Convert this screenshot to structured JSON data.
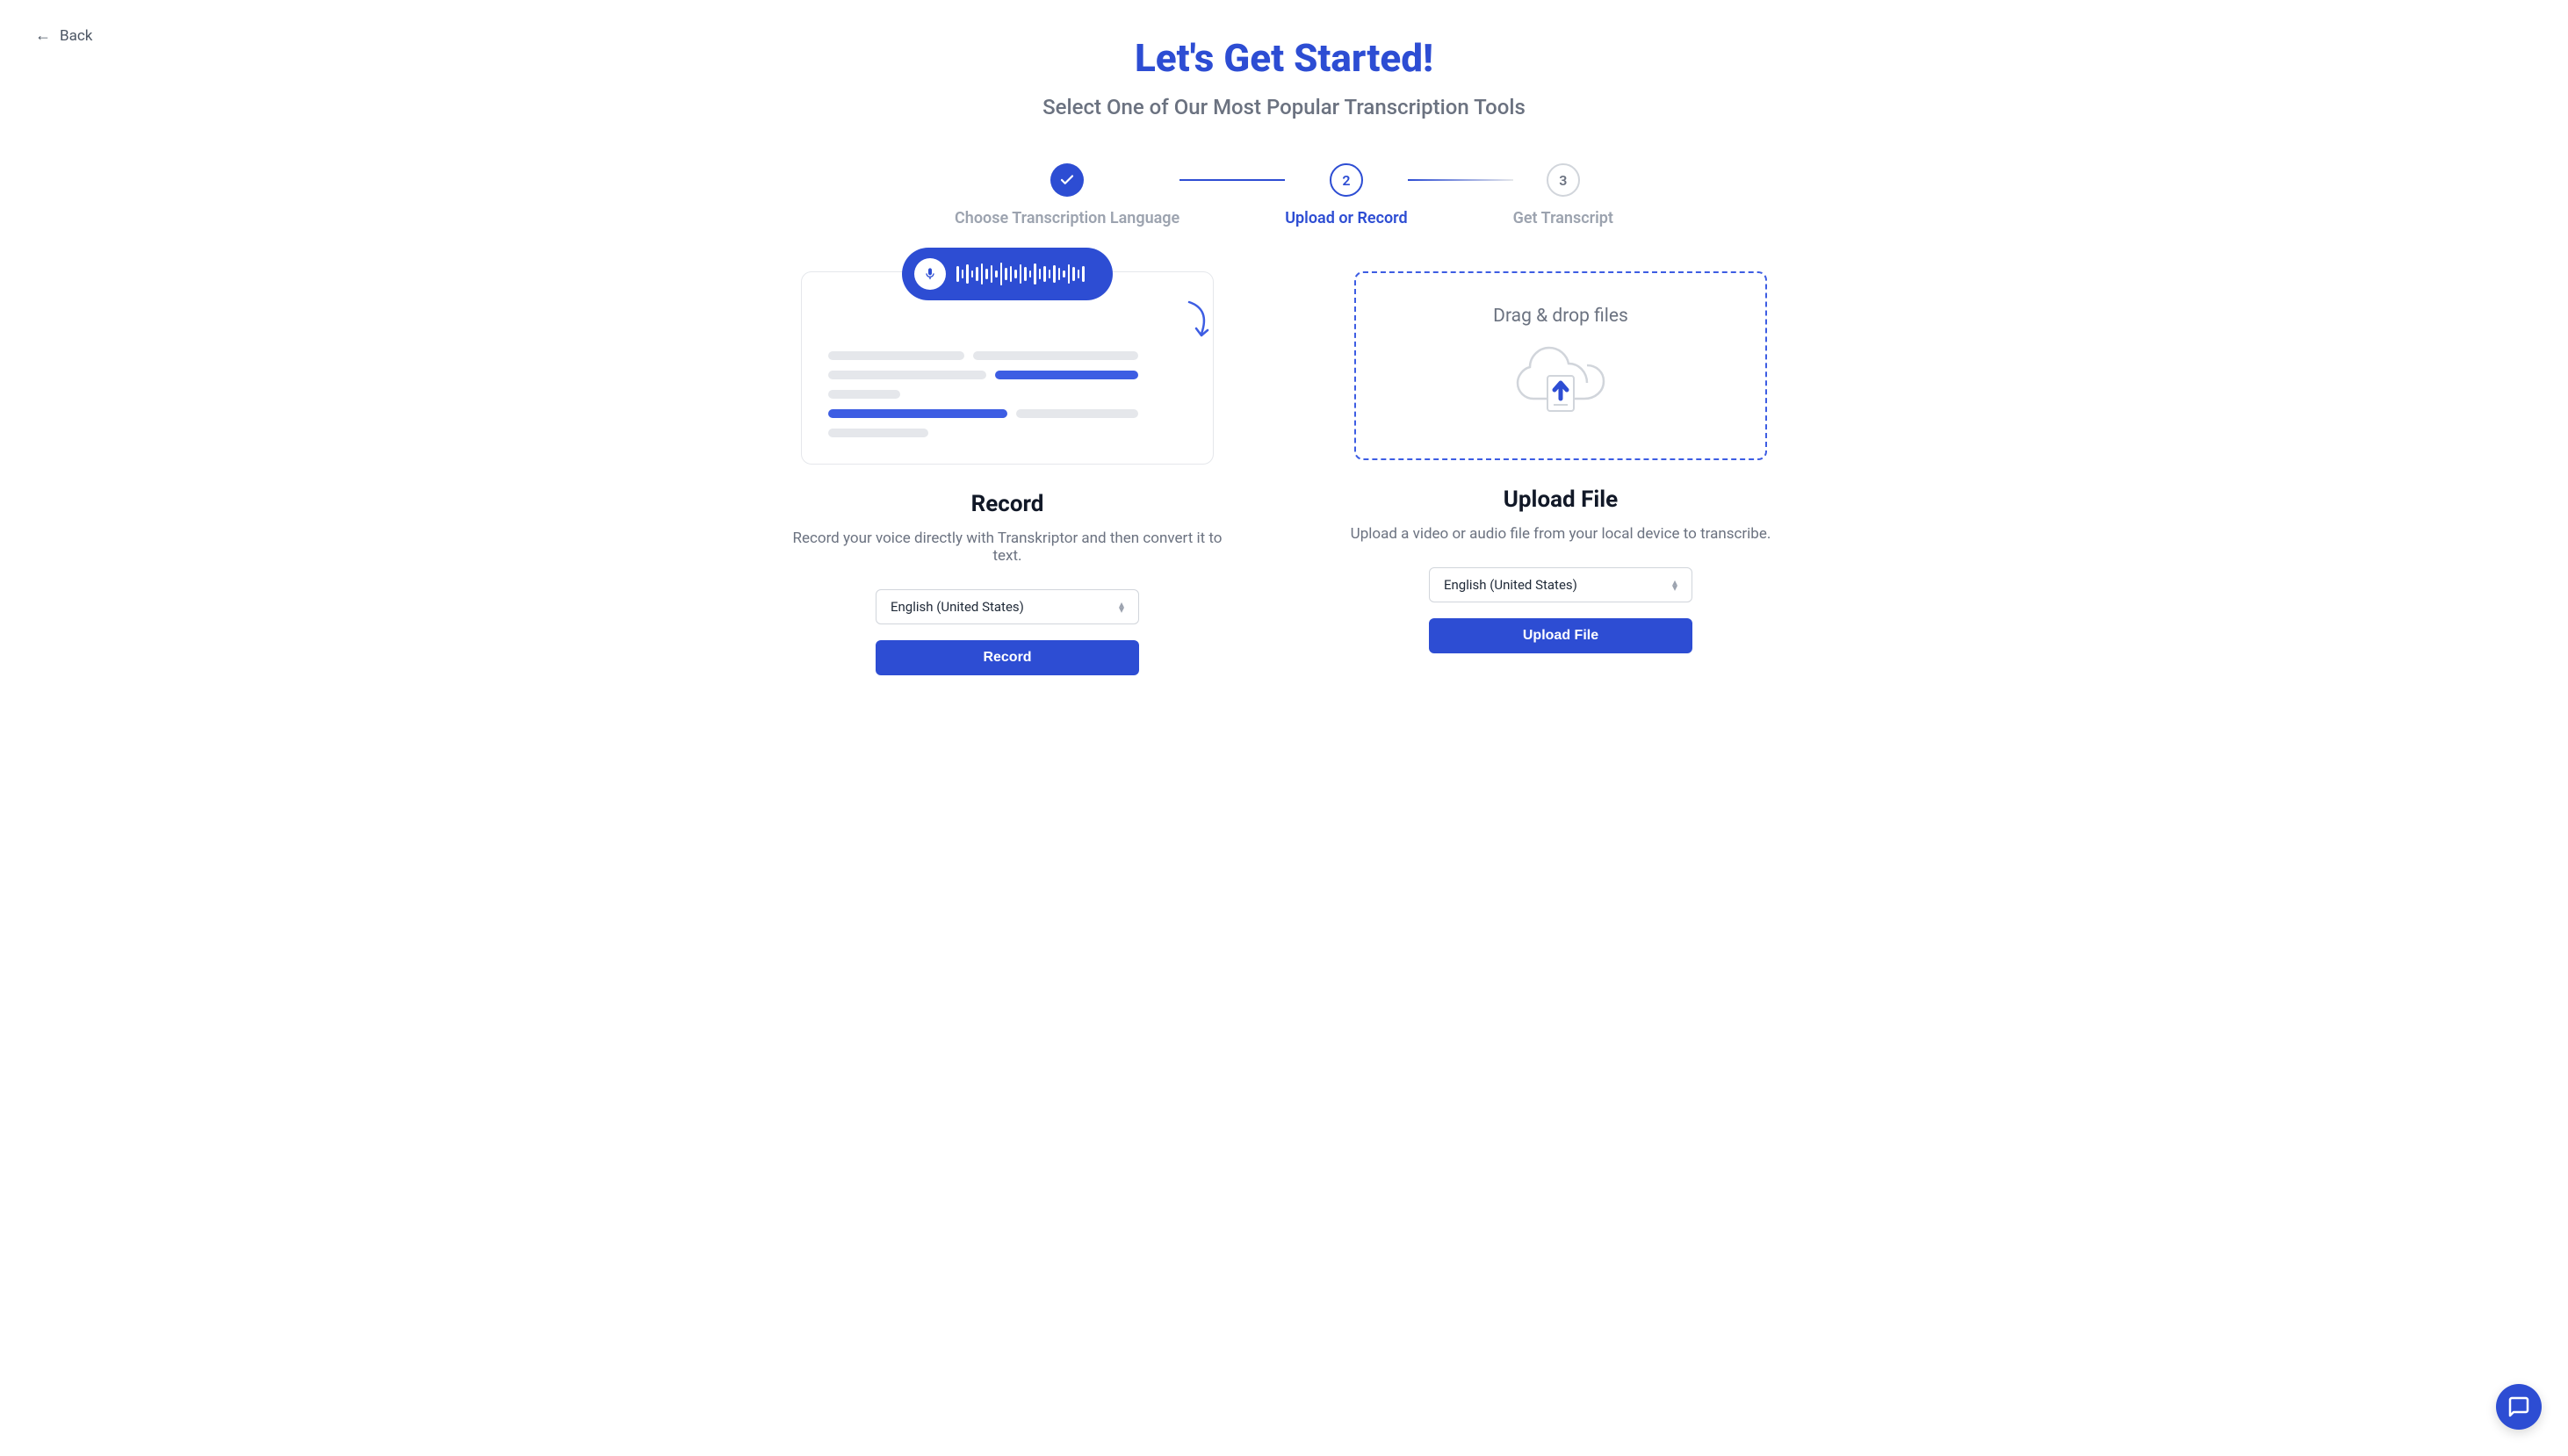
{
  "back": {
    "label": "Back"
  },
  "header": {
    "title": "Let's Get Started!",
    "subtitle": "Select One of Our Most Popular Transcription Tools"
  },
  "stepper": {
    "steps": [
      {
        "label": "Choose Transcription Language",
        "status": "completed"
      },
      {
        "number": "2",
        "label": "Upload or Record",
        "status": "active"
      },
      {
        "number": "3",
        "label": "Get Transcript",
        "status": "pending"
      }
    ]
  },
  "record": {
    "title": "Record",
    "description": "Record your voice directly with Transkriptor and then convert it to text.",
    "language": "English (United States)",
    "button": "Record"
  },
  "upload": {
    "dropzone_text": "Drag & drop files",
    "title": "Upload File",
    "description": "Upload a video or audio file from your local device to transcribe.",
    "language": "English (United States)",
    "button": "Upload File"
  }
}
